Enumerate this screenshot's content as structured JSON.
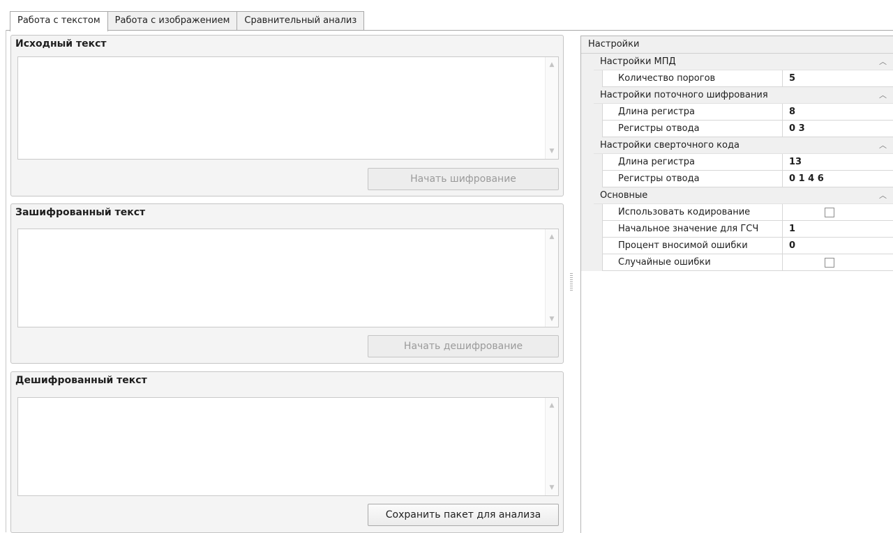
{
  "tabs": [
    {
      "label": "Работа с текстом",
      "active": true
    },
    {
      "label": "Работа с изображением",
      "active": false
    },
    {
      "label": "Сравнительный анализ",
      "active": false
    }
  ],
  "panels": {
    "source": {
      "title": "Исходный текст",
      "text": "",
      "button": "Начать шифрование",
      "button_enabled": false
    },
    "encrypted": {
      "title": "Зашифрованный текст",
      "text": "",
      "button": "Начать дешифрование",
      "button_enabled": false
    },
    "decrypted": {
      "title": "Дешифрованный текст",
      "text": "",
      "button": "Сохранить пакет для анализа",
      "button_enabled": true
    }
  },
  "settings": {
    "header": "Настройки",
    "categories": [
      {
        "name": "Настройки МПД",
        "rows": [
          {
            "name": "Количество порогов",
            "value": "5"
          }
        ]
      },
      {
        "name": "Настройки поточного шифрования",
        "rows": [
          {
            "name": "Длина регистра",
            "value": "8"
          },
          {
            "name": "Регистры отвода",
            "value": "0 3"
          }
        ]
      },
      {
        "name": "Настройки сверточного кода",
        "rows": [
          {
            "name": "Длина регистра",
            "value": "13"
          },
          {
            "name": "Регистры отвода",
            "value": "0 1 4 6"
          }
        ]
      },
      {
        "name": "Основные",
        "rows": [
          {
            "name": "Использовать кодирование",
            "checkbox": false
          },
          {
            "name": "Начальное значение для ГСЧ",
            "value": "1"
          },
          {
            "name": "Процент вносимой ошибки",
            "value": "0"
          },
          {
            "name": "Случайные ошибки",
            "checkbox": false
          }
        ]
      }
    ]
  },
  "icons": {
    "collapse": "chevron-up-icon",
    "scroll_up": "scroll-up-arrow-icon",
    "scroll_down": "scroll-down-arrow-icon"
  }
}
